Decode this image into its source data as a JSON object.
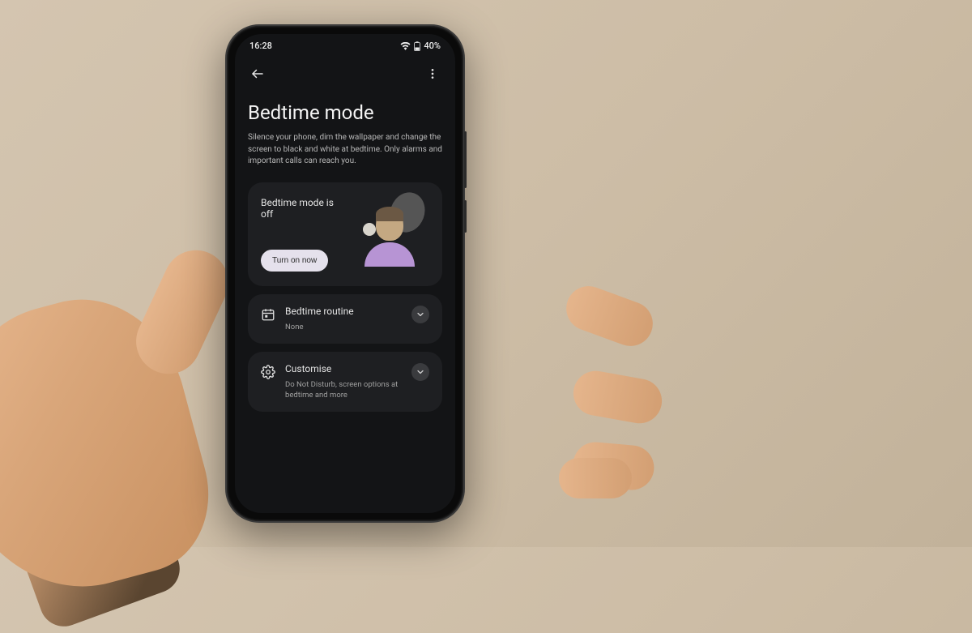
{
  "statusbar": {
    "time": "16:28",
    "battery": "40%"
  },
  "page": {
    "title": "Bedtime mode",
    "description": "Silence your phone, dim the wallpaper and change the screen to black and white at bedtime. Only alarms and important calls can reach you."
  },
  "status_card": {
    "title": "Bedtime mode is off",
    "button_label": "Turn on now"
  },
  "routine_card": {
    "title": "Bedtime routine",
    "subtitle": "None"
  },
  "customise_card": {
    "title": "Customise",
    "subtitle": "Do Not Disturb, screen options at bedtime and more"
  }
}
